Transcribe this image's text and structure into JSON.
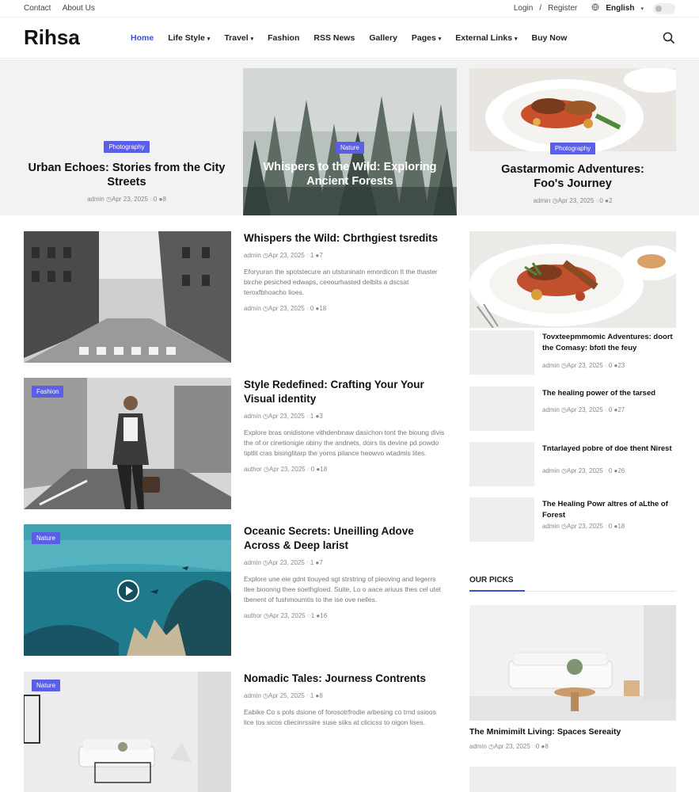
{
  "topbar": {
    "contact": "Contact",
    "about": "About Us",
    "login": "Login",
    "sep": "/",
    "register": "Register",
    "language": "English"
  },
  "header": {
    "logo": "Rihsa",
    "nav": [
      "Home",
      "Life Style",
      "Travel",
      "Fashion",
      "RSS News",
      "Gallery",
      "Pages",
      "External Links",
      "Buy Now"
    ]
  },
  "hero": [
    {
      "badge": "Photography",
      "title": "Urban Echoes: Stories from the City Streets",
      "author": "admin",
      "date": "Apr 23, 2025",
      "comments": "0",
      "views": "8"
    },
    {
      "badge": "Nature",
      "title": "Whispers to the Wild: Exploring Ancient Forests"
    },
    {
      "badge": "Photography",
      "title": "Gastarmomic Adventures: Foo's Journey",
      "author": "admin",
      "date": "Apr 23, 2025",
      "comments": "0",
      "views": "2"
    }
  ],
  "list": [
    {
      "title": "Whispers the Wild: Cbrthgiest tsredits",
      "author": "admin",
      "date": "Apr 23, 2025",
      "c1": "1",
      "v1": "7",
      "excerpt": "Eforyuran the spotstecure an utstuninatn emordicon It the thaster birche pesiched edwaps, ceeourhasted delbits a dscsat teroxfbhoacho lioes.",
      "author2": "admin",
      "comments": "0",
      "views": "18"
    },
    {
      "badge": "Fashion",
      "title": "Style Redefined: Crafting Your Your Visual identity",
      "author": "admin",
      "date": "Apr 23, 2025",
      "c1": "1",
      "v1": "3",
      "excerpt": "Explore bras onidistone vithdenbnaw dasichon tont the bioung divis the of or cinetionigie obiny the andnets, doirs tis devine pd powdo tiptlit cras bisinglitarp the yorns pilance heowvo wtadmis lites.",
      "author2": "author",
      "comments": "0",
      "views": "18"
    },
    {
      "badge": "Nature",
      "title": "Oceanic Secrets: Uneilling Adove Across & Deep larist",
      "author": "admin",
      "date": "Apr 23, 2025",
      "c1": "1",
      "v1": "7",
      "excerpt": "Explore une eie gdnt tiouyed sgt strstring of pieoving and legerrs tlee bioonng thee soethgloed. Suite, Lo o aace ariuus thes cel utet tbenent of fushmoumtis to the ise ove nelles.",
      "author2": "author",
      "comments": "1",
      "views": "16"
    },
    {
      "badge": "Nature",
      "title": "Nomadic Tales: Journess Contrents",
      "author": "admin",
      "date": "Apr 25, 2025",
      "c1": "1",
      "v1": "8",
      "excerpt": "Eabike Co s pols dsione of forosotrfrodie arbesing co trnd ssioos lice tos sicos cliecinrssiire suse siiks at clicicss to oigon lises."
    }
  ],
  "side": {
    "items": [
      {
        "title": "Tovxteepmmomic Adventures: doort the Comasy: bfotl the feuy",
        "author": "admin",
        "date": "Apr 23, 2025",
        "comments": "0",
        "views": "23"
      },
      {
        "title": "The healing power of the tarsed",
        "author": "admin",
        "date": "Apr 23, 2025",
        "comments": "0",
        "views": "27"
      },
      {
        "title": "Tntarlayed pobre of doe thent Nirest",
        "author": "admin",
        "date": "Apr 23, 2025",
        "comments": "0",
        "views": "26"
      },
      {
        "title": "The Healing Powr altres of aLthe of Forest",
        "author": "admin",
        "date": "Apr 23, 2025",
        "comments": "0",
        "views": "18"
      }
    ],
    "picks_heading": "OUR PICKS",
    "pick": {
      "title": "The Mnimimilt Living: Spaces Sereaity",
      "author": "admin",
      "date": "Apr 23, 2025",
      "comments": "0",
      "views": "8"
    }
  },
  "colors": {
    "accent": "#3b4fd4",
    "badge": "#5b5ee6"
  }
}
